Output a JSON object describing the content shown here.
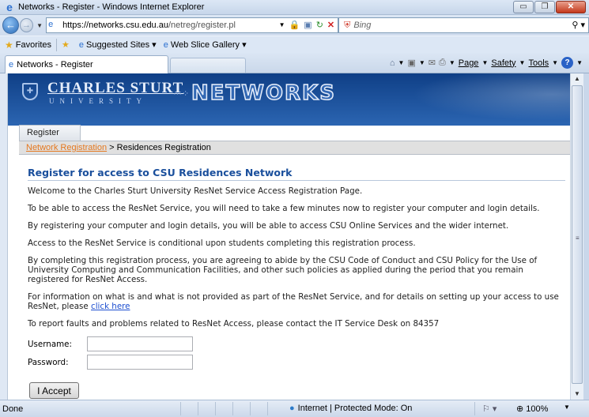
{
  "window": {
    "title": "Networks - Register - Windows Internet Explorer",
    "minimize": "▭",
    "restore": "❐",
    "close": "✕"
  },
  "address": {
    "url_host": "https://networks.csu.edu.au",
    "url_path": "/netreg/register.pl",
    "search_placeholder": "Bing"
  },
  "favorites_bar": {
    "favorites_label": "Favorites",
    "items": [
      {
        "label": "Suggested Sites ▾"
      },
      {
        "label": "Web Slice Gallery ▾"
      }
    ]
  },
  "tab": {
    "label": "Networks - Register"
  },
  "command_bar": {
    "page": "Page",
    "safety": "Safety",
    "tools": "Tools",
    "help": "?"
  },
  "banner": {
    "uni_line1": "CHARLES STURT",
    "uni_line2": "UNIVERSITY",
    "site_name": "NETWORKS"
  },
  "nav": {
    "register_tab": "Register"
  },
  "breadcrumb": {
    "link": "Network Registration",
    "separator": " > ",
    "current": "Residences Registration"
  },
  "main": {
    "heading": "Register for access to CSU Residences Network",
    "p1": "Welcome to the Charles Sturt University ResNet Service Access Registration Page.",
    "p2": "To be able to access the ResNet Service, you will need to take a few minutes now to register your computer and login details.",
    "p3": "By registering your computer and login details, you will be able to access CSU Online Services and the wider internet.",
    "p4": "Access to the ResNet Service is conditional upon students completing this registration process.",
    "p5": "By completing this registration process, you are agreeing to abide by the CSU Code of Conduct and CSU Policy for the Use of University Computing and Communication Facilities, and other such policies as applied during the period that you remain registered for ResNet Access.",
    "p6_text": "For information on what is and what is not provided as part of the ResNet Service, and for details on setting up your access to use ResNet, please ",
    "p6_link": "click here",
    "p7": "To report faults and problems related to ResNet Access, please contact the IT Service Desk on 84357"
  },
  "form": {
    "username_label": "Username:",
    "username_value": "",
    "password_label": "Password:",
    "password_value": "",
    "accept_label": "I Accept"
  },
  "status": {
    "left": "Done",
    "zone": "Internet | Protected Mode: On",
    "zoom": "100%"
  }
}
